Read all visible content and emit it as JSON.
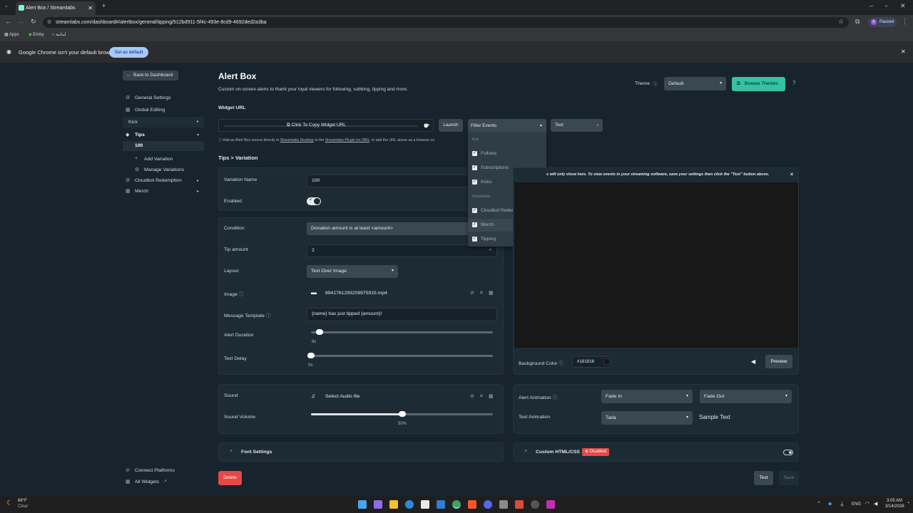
{
  "browser": {
    "tab_title": "Alert Box / Streamlabs",
    "url": "streamlabs.com/dashboard#/alertbox/general/tipping/512bd911-5f4c-493e-8cd9-4692ded2a3ba",
    "bookmarks": [
      "Apps",
      "Emby",
      "لبنانية"
    ],
    "profile_label": "Paused",
    "profile_initial": "F",
    "infobar_text": "Google Chrome isn't your default browser",
    "set_default_label": "Set as default"
  },
  "sidebar": {
    "back_label": "Back to Dashboard",
    "items": [
      {
        "label": "General Settings",
        "icon": "gear-icon"
      },
      {
        "label": "Global Editing",
        "icon": "grid-icon"
      },
      {
        "label": "Kick",
        "icon": ""
      },
      {
        "label": "Tips",
        "icon": "tag-icon"
      },
      {
        "label": "100",
        "icon": ""
      },
      {
        "label": "Add Variation",
        "icon": "plus-icon"
      },
      {
        "label": "Manage Variations",
        "icon": "gear-icon"
      },
      {
        "label": "Cloudbot Redemption",
        "icon": "gear-icon"
      },
      {
        "label": "Merch",
        "icon": "grid-icon"
      }
    ],
    "bottom": [
      {
        "label": "Connect Platforms"
      },
      {
        "label": "All Widgets"
      }
    ]
  },
  "header": {
    "title": "Alert Box",
    "subtitle": "Custom on-screen alerts to thank your loyal viewers for following, subbing, tipping and more.",
    "theme_label": "Theme",
    "theme_value": "Default",
    "browse_themes_label": "Browse Themes"
  },
  "widget_url": {
    "label": "Widget URL",
    "copy_label": "Click To Copy Widget URL",
    "launch_label": "Launch",
    "filter_label": "Filter Events",
    "test_label": "Test",
    "hint_prefix": "Add an Alert Box source directly in",
    "hint_link1": "Streamlabs Desktop",
    "hint_mid": "or the",
    "hint_link2": "Streamlabs Plugin for OBS",
    "hint_suffix": ", or add the URL above as a browser so"
  },
  "filter_dropdown": {
    "groups": [
      {
        "header": "Kick",
        "items": [
          "Follows",
          "Subscriptions",
          "Kicks"
        ]
      },
      {
        "header": "Streamlabs",
        "items": [
          "Cloudbot Redemption",
          "Merch",
          "Tipping"
        ]
      }
    ]
  },
  "breadcrumb": "Tips > Variation",
  "form": {
    "variation_name_label": "Variation Name",
    "variation_name_value": "100",
    "enabled_label": "Enabled",
    "condition_label": "Condition",
    "condition_value": "Donation amount is at least <amount>",
    "tip_amount_label": "Tip amount",
    "tip_amount_value": "2",
    "layout_label": "Layout",
    "layout_value": "Text Over Image",
    "image_label": "Image",
    "image_value": "8941761293209975915.mp4",
    "message_template_label": "Message Template",
    "message_template_value": "{name} has just tipped {amount}!",
    "alert_duration_label": "Alert Duration",
    "alert_duration_value": "8s",
    "alert_duration_fraction": 0.03,
    "text_delay_label": "Text Delay",
    "text_delay_value": "0s",
    "text_delay_fraction": 0.0
  },
  "sound": {
    "sound_label": "Sound",
    "sound_value": "Select Audio file",
    "volume_label": "Sound Volume",
    "volume_value": "50%",
    "volume_fraction": 0.5
  },
  "font_settings_label": "Font Settings",
  "preview": {
    "notice": "s will only show here. To view events in your streaming software, save your settings then click the \"Test\" button above.",
    "bg_color_label": "Background Color",
    "bg_color_value": "#181818",
    "preview_label": "Preview"
  },
  "animation": {
    "alert_animation_label": "Alert Animation",
    "alert_in": "Fade In",
    "alert_out": "Fade Out",
    "text_animation_label": "Text Animation",
    "text_value": "Tada",
    "sample_text": "Sample Text"
  },
  "custom_css": {
    "label": "Custom HTML/CSS",
    "badge": "Disabled"
  },
  "footer": {
    "delete_label": "Delete",
    "test_label": "Test",
    "save_label": "Save"
  },
  "taskbar": {
    "weather_temp": "68°F",
    "weather_cond": "Clear",
    "lang": "ENG",
    "time": "3:05 AM",
    "date": "3/14/2026"
  },
  "colors": {
    "accent": "#31c3a2",
    "danger": "#e64848",
    "panel": "#1d2b34",
    "background": "#17242d"
  }
}
